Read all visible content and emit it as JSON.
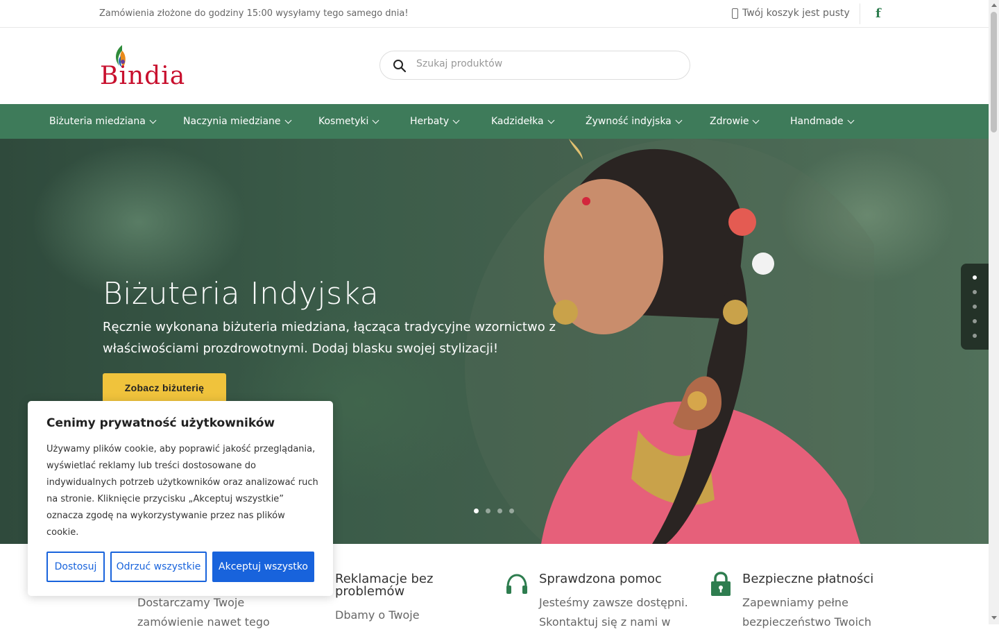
{
  "topbar": {
    "message": "Zamówienia złożone do godziny 15:00 wysyłamy tego samego dnia!",
    "cart_text": "Twój koszyk jest pusty",
    "facebook_glyph": "f"
  },
  "header": {
    "logo_text": "Bindia",
    "search_placeholder": "Szukaj produktów"
  },
  "nav": {
    "items": [
      {
        "label": "Biżuteria miedziana"
      },
      {
        "label": "Naczynia miedziane"
      },
      {
        "label": "Kosmetyki"
      },
      {
        "label": "Herbaty"
      },
      {
        "label": "Kadzidełka"
      },
      {
        "label": "Żywność indyjska"
      },
      {
        "label": "Zdrowie"
      },
      {
        "label": "Handmade"
      }
    ]
  },
  "hero": {
    "title": "Biżuteria Indyjska",
    "text": "Ręcznie wykonana biżuteria miedziana, łącząca tradycyjne wzornictwo z właściwościami prozdrowotnymi. Dodaj blasku swojej stylizacji!",
    "button_label": "Zobacz biżuterię",
    "slide_count": 4,
    "active_slide": 1,
    "side_nav_count": 5,
    "side_nav_active": 1
  },
  "features": [
    {
      "title": "",
      "text_lines": [
        "Dostarczamy Twoje",
        "zamówienie nawet tego"
      ],
      "icon": "truck-icon"
    },
    {
      "title_lines": [
        "Reklamacje bez",
        "problemów"
      ],
      "text_lines": [
        "Dbamy o Twoje"
      ],
      "icon": "return-icon"
    },
    {
      "title": "Sprawdzona pomoc",
      "text_lines": [
        "Jesteśmy zawsze dostępni.",
        "Skontaktuj się z nami w"
      ],
      "icon": "headphones-icon"
    },
    {
      "title": "Bezpieczne płatności",
      "text_lines": [
        "Zapewniamy pełne",
        "bezpieczeństwo Twoich"
      ],
      "icon": "lock-icon"
    }
  ],
  "cookie": {
    "title": "Cenimy prywatność użytkowników",
    "text": "Używamy plików cookie, aby poprawić jakość przeglądania, wyświetlać reklamy lub treści dostosowane do indywidualnych potrzeb użytkowników oraz analizować ruch na stronie. Kliknięcie przycisku „Akceptuj wszystkie” oznacza zgodę na wykorzystywanie przez nas plików cookie.",
    "customize_label": "Dostosuj",
    "reject_label": "Odrzuć wszystkie",
    "accept_label": "Akceptuj wszystko"
  },
  "colors": {
    "nav_green": "#3e7b5a",
    "icon_green": "#2e7d4f",
    "cta_yellow": "#f0c33c",
    "cookie_blue": "#1863dc",
    "logo_red": "#c8102e"
  }
}
